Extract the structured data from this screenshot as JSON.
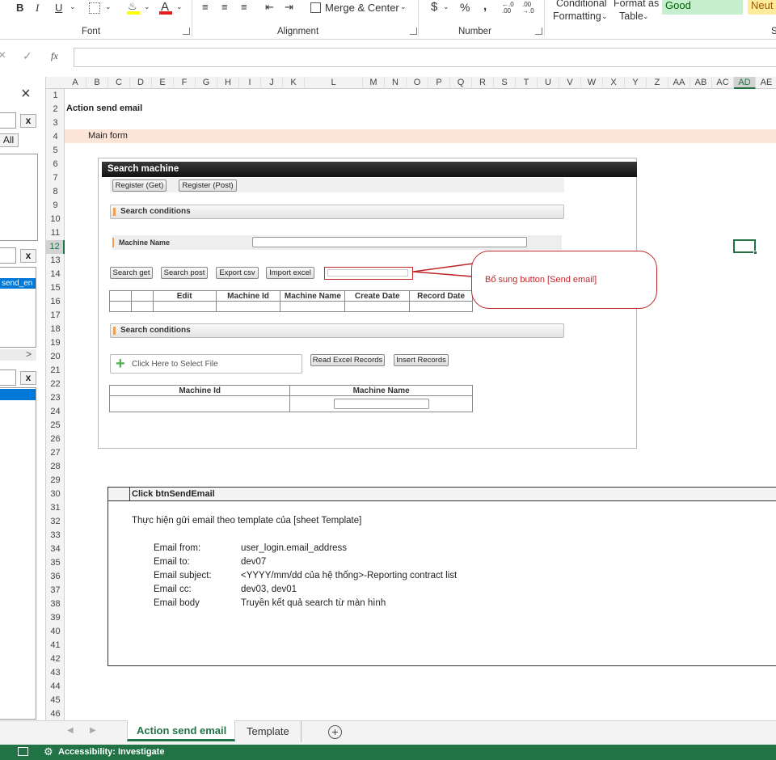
{
  "ribbon": {
    "groups": {
      "font": "Font",
      "alignment": "Alignment",
      "number": "Number"
    },
    "font_buttons": {
      "bold": "B",
      "italic": "I",
      "underline": "U",
      "font_color": "A"
    },
    "merge_center": "Merge & Center",
    "number_buttons": {
      "currency": "$",
      "percent": "%",
      "comma": ",",
      "inc_decimal": "←.0 .00",
      "dec_decimal": ".00 →.0"
    },
    "conditional_formatting": {
      "line1": "Conditional",
      "line2": "Formatting"
    },
    "format_as_table": {
      "line1": "Format as",
      "line2": "Table"
    },
    "styles": {
      "good": "Good",
      "neutral": "Neut",
      "cut": "S"
    },
    "colors": {
      "good_bg": "#c6efce",
      "good_fg": "#006100",
      "neutral_bg": "#ffeb9c",
      "neutral_fg": "#9c5700",
      "font_red": "#e02020",
      "fill_yellow": "#ffff00"
    }
  },
  "formula_bar": {
    "cancel": "×",
    "enter": "✓",
    "fx": "fx",
    "value": ""
  },
  "columns": [
    "A",
    "B",
    "C",
    "D",
    "E",
    "F",
    "G",
    "H",
    "I",
    "J",
    "K",
    "L",
    "M",
    "N",
    "O",
    "P",
    "Q",
    "R",
    "S",
    "T",
    "U",
    "V",
    "W",
    "X",
    "Y",
    "Z",
    "AA",
    "AB",
    "AC",
    "AD",
    "AE"
  ],
  "rows": [
    "1",
    "2",
    "3",
    "4",
    "5",
    "6",
    "7",
    "8",
    "9",
    "10",
    "11",
    "12",
    "13",
    "14",
    "15",
    "16",
    "17",
    "18",
    "19",
    "20",
    "21",
    "22",
    "23",
    "24",
    "25",
    "26",
    "27",
    "28",
    "29",
    "30",
    "31",
    "32",
    "33",
    "34",
    "35",
    "36",
    "37",
    "38",
    "39",
    "40",
    "41",
    "42",
    "43",
    "44",
    "45",
    "46"
  ],
  "active_cell": {
    "column": "AD",
    "row": "12"
  },
  "side_pane": {
    "close": "×",
    "x": "x",
    "all": "All",
    "list_item": "send_en",
    "scroll_right": ">"
  },
  "sheet": {
    "title": "Action send email",
    "section": "Main form",
    "section_bg": "#fce4d6",
    "mockup": {
      "header": "Search machine",
      "register_get": "Register (Get)",
      "register_post": "Register (Post)",
      "search_conditions_1": "Search conditions",
      "machine_name_label": "Machine Name",
      "buttons": [
        "Search get",
        "Search post",
        "Export csv",
        "Import excel"
      ],
      "table_headers": [
        "",
        "",
        "Edit",
        "Machine Id",
        "Machine Name",
        "Create Date",
        "Record Date"
      ],
      "search_conditions_2": "Search conditions",
      "file_select": "Click Here to Select File",
      "read_excel": "Read Excel Records",
      "insert_records": "Insert Records",
      "table2_headers": [
        "Machine Id",
        "Machine Name"
      ]
    },
    "callout": "Bổ sung button [Send email]",
    "desc": {
      "header": "Click btnSendEmail",
      "intro": "Thực hiện gửi email theo template của  [sheet Template]",
      "fields": [
        {
          "label": "Email from:",
          "value": "user_login.email_address"
        },
        {
          "label": "Email to:",
          "value": "dev07"
        },
        {
          "label": "Email subject:",
          "value": "<YYYY/mm/dd của hệ thống>-Reporting contract list"
        },
        {
          "label": "Email cc:",
          "value": "dev03, dev01"
        },
        {
          "label": "Email body",
          "value": "Truyền kết quả search từ màn hình"
        }
      ]
    }
  },
  "tabs": [
    {
      "label": "Action send email",
      "active": true
    },
    {
      "label": "Template",
      "active": false
    }
  ],
  "add_sheet": "+",
  "status": {
    "accessibility": "Accessibility: Investigate"
  }
}
